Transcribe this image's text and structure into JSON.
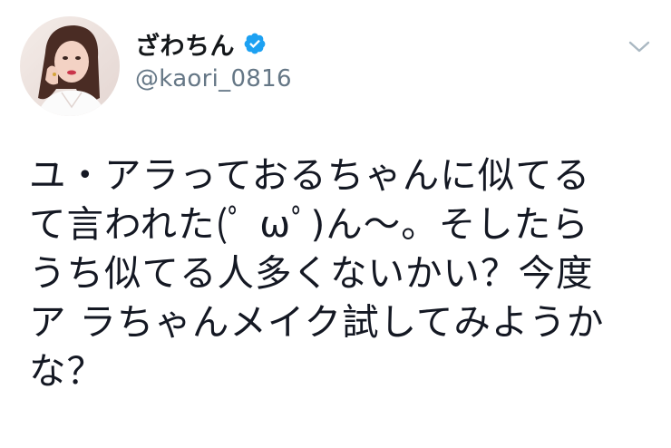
{
  "author": {
    "display_name": "ざわちん",
    "handle": "@kaori_0816",
    "verified": true,
    "verified_color": "#1da1f2"
  },
  "tweet": {
    "lines": [
      "ユ・アラっておるちゃんに似てる",
      "て言われた(ﾟ ωﾟ)ん〜。そしたら",
      "うち似てる人多くないかい？今度",
      "ア ラちゃんメイク試してみようか",
      "な？"
    ]
  },
  "icons": {
    "verified": "verified-badge-icon",
    "menu": "chevron-down-icon"
  },
  "colors": {
    "text": "#141823",
    "secondary": "#657786",
    "caret": "#aab8c2"
  }
}
